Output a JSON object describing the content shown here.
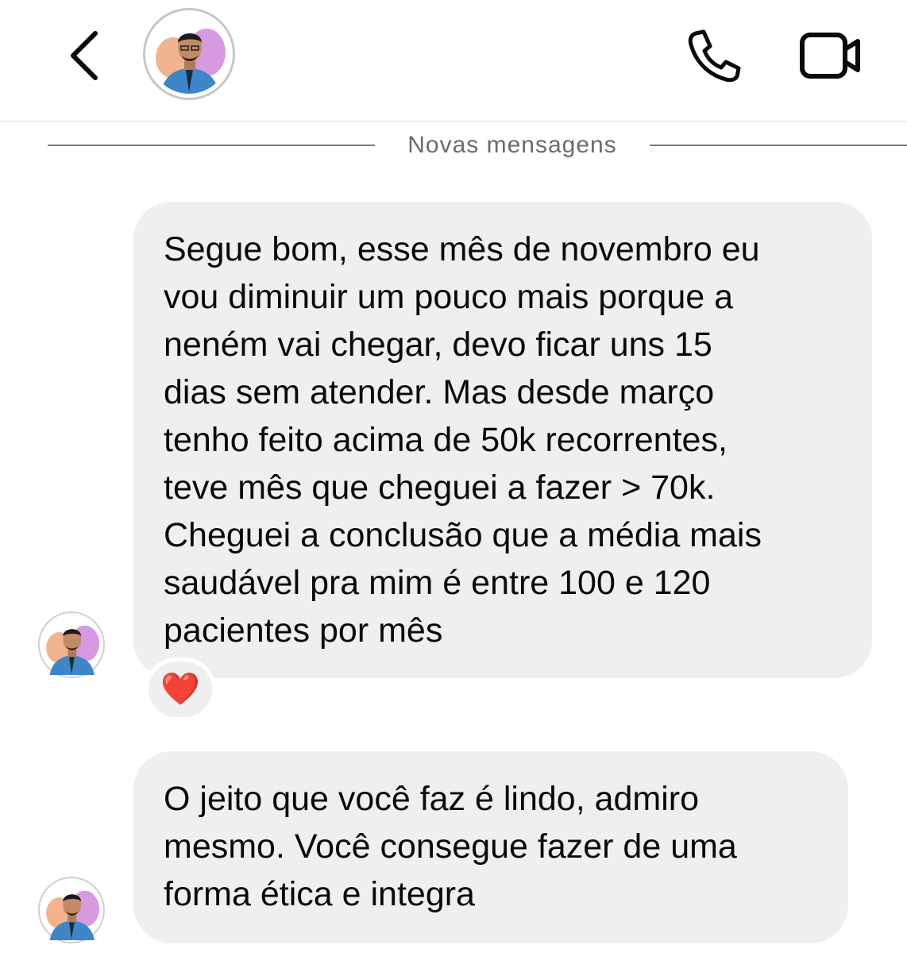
{
  "header": {
    "contact_name": "",
    "back_icon": "chevron-left-icon",
    "call_icon": "phone-icon",
    "video_icon": "video-camera-icon"
  },
  "divider": {
    "label": "Novas mensagens"
  },
  "messages": [
    {
      "text": "Segue bom, esse mês de novembro eu\nvou diminuir um pouco mais porque a\nneném vai chegar, devo ficar uns 15\ndias sem atender. Mas desde março\ntenho feito acima de 50k recorrentes,\nteve mês que cheguei a fazer > 70k.\nCheguei a conclusão que a média mais\nsaudável pra mim é entre 100 e 120\npacientes por mês",
      "reaction": "❤️"
    },
    {
      "text": "O jeito que você faz é lindo, admiro\nmesmo. Você consegue fazer de uma\nforma ética e integra"
    }
  ],
  "colors": {
    "bubble_background": "#efefef",
    "divider_line": "#7a7a7a",
    "divider_text": "#6b6b6b",
    "icon_stroke": "#0a0a0a"
  }
}
